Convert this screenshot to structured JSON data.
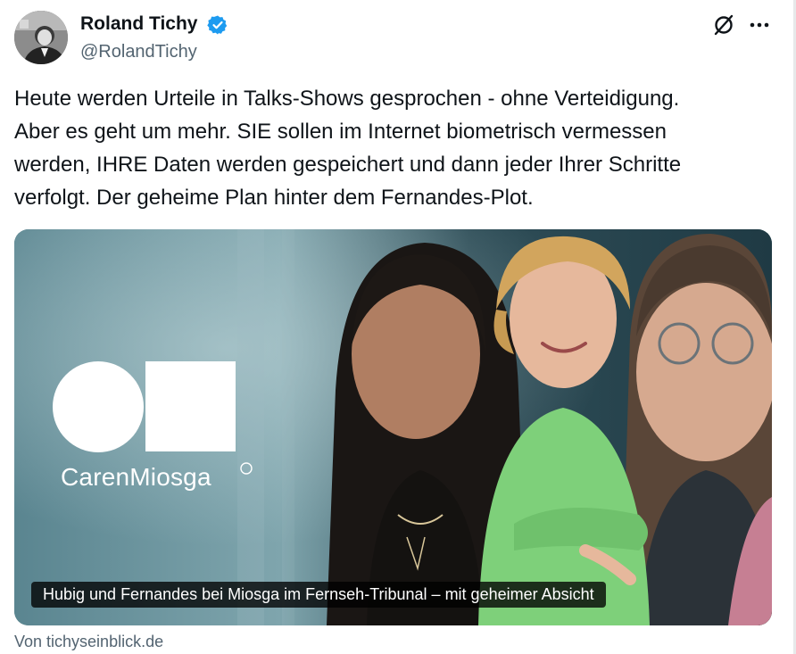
{
  "author": {
    "name": "Roland Tichy",
    "handle": "@RolandTichy",
    "verified": true
  },
  "icons": {
    "verified": "verified-badge-icon",
    "grok": "grok-icon",
    "more": "more-options-icon"
  },
  "tweet": {
    "text": "Heute werden Urteile in Talks-Shows gesprochen - ohne Verteidigung.\nAber es geht um mehr. SIE sollen im Internet biometrisch vermessen\nwerden, IHRE Daten werden gespeichert und dann jeder Ihrer Schritte\nverfolgt. Der geheime Plan hinter dem Fernandes-Plot."
  },
  "card": {
    "brand": "CarenMiosga",
    "registered_mark": "®",
    "title": "Hubig und Fernandes bei Miosga im Fernseh-Tribunal – mit geheimer Absicht",
    "source": "Von tichyseinblick.de"
  },
  "colors": {
    "text": "#0f1419",
    "secondary": "#536471",
    "verified_blue": "#1d9bf0",
    "accent_green": "#7ed07a"
  }
}
